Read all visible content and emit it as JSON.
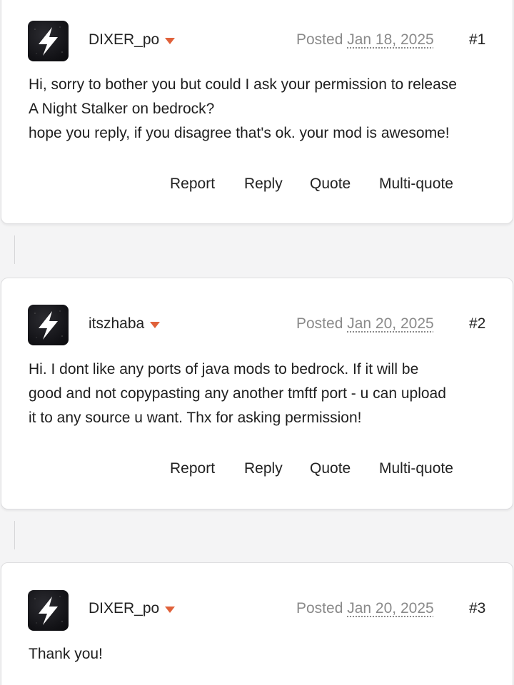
{
  "posts": [
    {
      "author": "DIXER_po",
      "posted_label": "Posted",
      "date": "Jan 18, 2025",
      "number": "#1",
      "content_lines": [
        "Hi, sorry to bother you but could I ask your permission to release",
        "A Night Stalker on bedrock?",
        "hope you reply, if you disagree that's ok. your mod is awesome!"
      ]
    },
    {
      "author": "itszhaba",
      "posted_label": "Posted",
      "date": "Jan 20, 2025",
      "number": "#2",
      "content_lines": [
        "Hi. I dont like any ports of java mods to bedrock. If it will be",
        "good and not copypasting any another tmftf port - u can upload",
        "it to any source u want. Thx for asking permission!"
      ]
    },
    {
      "author": "DIXER_po",
      "posted_label": "Posted",
      "date": "Jan 20, 2025",
      "number": "#3",
      "content_lines": [
        "Thank you!"
      ]
    }
  ],
  "actions": {
    "report": "Report",
    "reply": "Reply",
    "quote": "Quote",
    "multiquote": "Multi-quote"
  },
  "avatar_icon": "lightning-bolt-icon",
  "colors": {
    "accent_caret": "#e0613a",
    "muted_text": "#8a8a8a",
    "avatar_bg": "#121216"
  }
}
